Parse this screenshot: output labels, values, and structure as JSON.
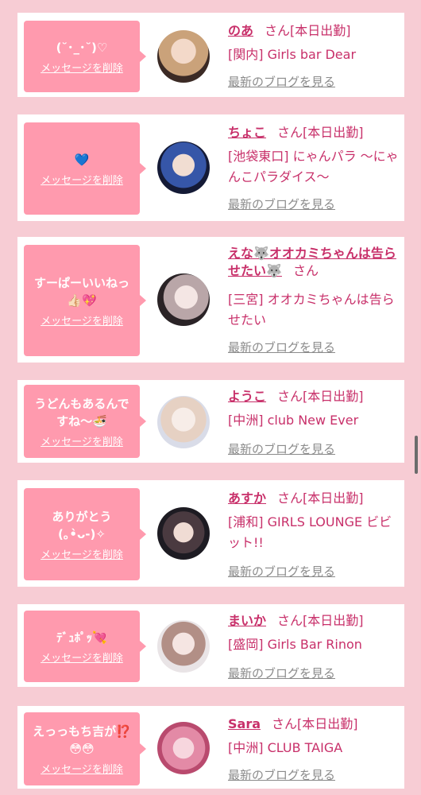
{
  "cards": [
    {
      "message": "(˘･_･˘)♡",
      "delete_label": "メッセージを削除",
      "name": "のあ",
      "san": "さん",
      "status": "[本日出勤]",
      "shop": "[関内] Girls bar Dear",
      "blog_label": "最新のブログを見る"
    },
    {
      "message": "💙",
      "delete_label": "メッセージを削除",
      "name": "ちょこ",
      "san": "さん",
      "status": "[本日出勤]",
      "shop": "[池袋東口] にゃんパラ 〜にゃんこパラダイス〜",
      "blog_label": "最新のブログを見る"
    },
    {
      "message": "すーぱーいいねっ👍🏻💖",
      "delete_label": "メッセージを削除",
      "name": "えな🐺オオカミちゃんは告らせたい🐺",
      "san": "さん",
      "status": "",
      "shop": "[三宮] オオカミちゃんは告らせたい",
      "blog_label": "最新のブログを見る"
    },
    {
      "message": "うどんもあるんですね〜🍜",
      "delete_label": "メッセージを削除",
      "name": "ようこ",
      "san": "さん",
      "status": "[本日出勤]",
      "shop": "[中洲] club New Ever",
      "blog_label": "最新のブログを見る"
    },
    {
      "message": "ありがとう\n(｡•̀ᴗ-)✧",
      "delete_label": "メッセージを削除",
      "name": "あすか",
      "san": "さん",
      "status": "[本日出勤]",
      "shop": "[浦和] GIRLS LOUNGE ビビット!!",
      "blog_label": "最新のブログを見る"
    },
    {
      "message": "ﾃﾞｭﾎﾟｯ💘",
      "delete_label": "メッセージを削除",
      "name": "まいか",
      "san": "さん",
      "status": "[本日出勤]",
      "shop": "[盛岡] Girls Bar Rinon",
      "blog_label": "最新のブログを見る"
    },
    {
      "message": "えっっもち吉が⁉️\n😳😳",
      "delete_label": "メッセージを削除",
      "name": "Sara",
      "san": "さん",
      "status": "[本日出勤]",
      "shop": "[中洲] CLUB TAIGA",
      "blog_label": "最新のブログを見る"
    }
  ],
  "colors": {
    "background": "#f7ccd4",
    "bubble": "#ff9aae",
    "name": "#c8306a",
    "blog_link": "#8b8b8b"
  }
}
